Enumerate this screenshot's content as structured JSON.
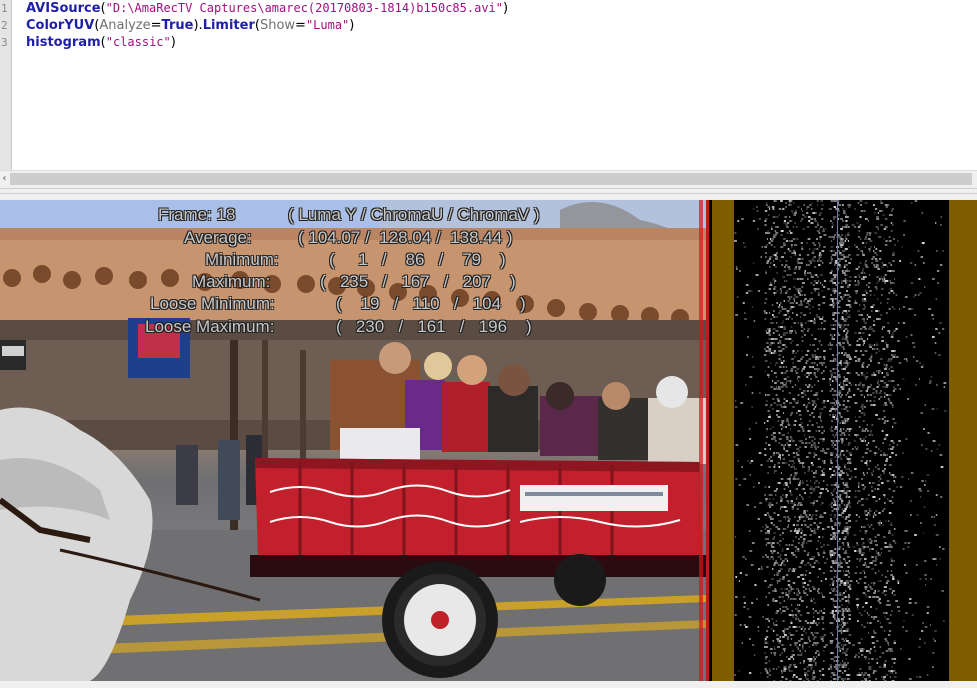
{
  "editor": {
    "line_numbers": [
      "1",
      "2",
      "3"
    ],
    "lines": [
      {
        "segments": [
          {
            "cls": "fn",
            "text": "AVISource"
          },
          {
            "cls": "pn",
            "text": "("
          },
          {
            "cls": "str",
            "text": "\"D:\\AmaRecTV Captures\\amarec(20170803-1814)b150c85.avi\""
          },
          {
            "cls": "pn",
            "text": ")"
          }
        ]
      },
      {
        "segments": [
          {
            "cls": "fn",
            "text": "ColorYUV"
          },
          {
            "cls": "pn",
            "text": "("
          },
          {
            "cls": "param",
            "text": "Analyze"
          },
          {
            "cls": "pn",
            "text": "="
          },
          {
            "cls": "kw",
            "text": "True"
          },
          {
            "cls": "pn",
            "text": ")."
          },
          {
            "cls": "fn",
            "text": "Limiter"
          },
          {
            "cls": "pn",
            "text": "("
          },
          {
            "cls": "param",
            "text": "Show"
          },
          {
            "cls": "pn",
            "text": "="
          },
          {
            "cls": "str",
            "text": "\"Luma\""
          },
          {
            "cls": "pn",
            "text": ")"
          }
        ]
      },
      {
        "segments": [
          {
            "cls": "fn",
            "text": "histogram"
          },
          {
            "cls": "pn",
            "text": "("
          },
          {
            "cls": "str",
            "text": "\"classic\""
          },
          {
            "cls": "pn",
            "text": ")"
          }
        ]
      }
    ]
  },
  "scrollbar": {
    "left_arrow": "‹"
  },
  "overlay": {
    "frame_label": "Frame: 18",
    "header": "( Luma Y / ChromaU / ChromaV )",
    "average_label": "Average:",
    "average_values": "( 104.07 /  128.04 /  138.44 )",
    "minimum_label": "Minimum:",
    "minimum_values": "(     1   /    86   /    79    )",
    "maximum_label": "Maximum:",
    "maximum_values": "(   235   /   167   /   207    )",
    "loose_min_label": "Loose Minimum:",
    "loose_min_values": "(    19   /   110   /   104    )",
    "loose_max_label": "Loose Maximum:",
    "loose_max_values": "(   230   /   161   /   196    )"
  },
  "colors": {
    "histogram_band": "#7e5d00",
    "histogram_center_line": "#1aa6a6",
    "function_blue": "#1f1fa8",
    "string_purple": "#a01080"
  }
}
